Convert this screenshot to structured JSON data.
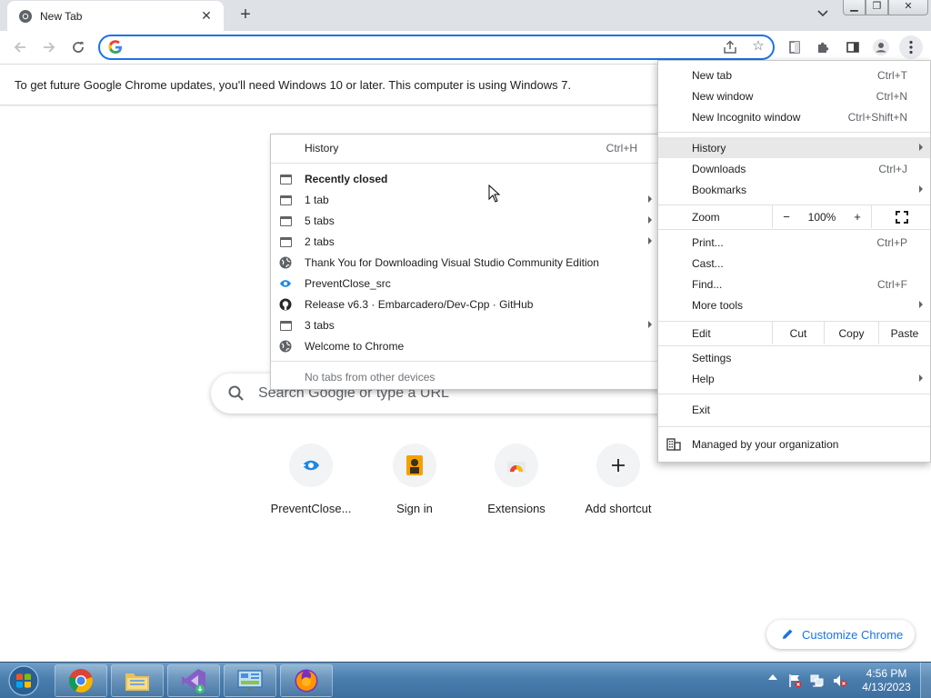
{
  "browser": {
    "tab_title": "New Tab",
    "omnibox": {
      "value": "",
      "placeholder": ""
    },
    "infobar_text": "To get future Google Chrome updates, you'll need Windows 10 or later. This computer is using Windows 7."
  },
  "ntp": {
    "search_placeholder": "Search Google or type a URL",
    "shortcuts": [
      {
        "label": "PreventClose...",
        "icon": "preventclose-icon"
      },
      {
        "label": "Sign in",
        "icon": "signin-icon"
      },
      {
        "label": "Extensions",
        "icon": "chrome-webstore-icon"
      },
      {
        "label": "Add shortcut",
        "icon": "plus-icon"
      }
    ],
    "customize_label": "Customize Chrome"
  },
  "history_menu": {
    "history": {
      "label": "History",
      "shortcut": "Ctrl+H"
    },
    "recently_closed_header": "Recently closed",
    "items": [
      {
        "label": "1 tab",
        "icon": "tab-icon",
        "submenu": true
      },
      {
        "label": "5 tabs",
        "icon": "tab-icon",
        "submenu": true
      },
      {
        "label": "2 tabs",
        "icon": "tab-icon",
        "submenu": true
      },
      {
        "label": "Thank You for Downloading Visual Studio Community Edition",
        "icon": "globe-icon",
        "submenu": false
      },
      {
        "label": "PreventClose_src",
        "icon": "preventclose-icon",
        "submenu": false
      },
      {
        "label": "Release v6.3 · Embarcadero/Dev-Cpp · GitHub",
        "icon": "github-icon",
        "submenu": false
      },
      {
        "label": "3 tabs",
        "icon": "tab-icon",
        "submenu": true
      },
      {
        "label": "Welcome to Chrome",
        "icon": "globe-icon",
        "submenu": false
      }
    ],
    "no_tabs_text": "No tabs from other devices"
  },
  "main_menu": {
    "new_tab": {
      "label": "New tab",
      "shortcut": "Ctrl+T"
    },
    "new_window": {
      "label": "New window",
      "shortcut": "Ctrl+N"
    },
    "new_incognito": {
      "label": "New Incognito window",
      "shortcut": "Ctrl+Shift+N"
    },
    "history": {
      "label": "History"
    },
    "downloads": {
      "label": "Downloads",
      "shortcut": "Ctrl+J"
    },
    "bookmarks": {
      "label": "Bookmarks"
    },
    "zoom": {
      "label": "Zoom",
      "minus": "−",
      "value": "100%",
      "plus": "+"
    },
    "print": {
      "label": "Print...",
      "shortcut": "Ctrl+P"
    },
    "cast": {
      "label": "Cast..."
    },
    "find": {
      "label": "Find...",
      "shortcut": "Ctrl+F"
    },
    "more_tools": {
      "label": "More tools"
    },
    "edit": {
      "label": "Edit",
      "cut": "Cut",
      "copy": "Copy",
      "paste": "Paste"
    },
    "settings": {
      "label": "Settings"
    },
    "help": {
      "label": "Help"
    },
    "exit": {
      "label": "Exit"
    },
    "managed": {
      "label": "Managed by your organization"
    }
  },
  "taskbar": {
    "time": "4:56 PM",
    "date": "4/13/2023",
    "apps": [
      "chrome-icon",
      "explorer-icon",
      "visual-studio-icon",
      "control-panel-icon",
      "firefox-icon"
    ]
  },
  "colors": {
    "accent": "#1a73e8",
    "tabstrip": "#dee1e6",
    "menu_highlight": "#e8e8e8",
    "taskbar": "#4a7eae"
  }
}
